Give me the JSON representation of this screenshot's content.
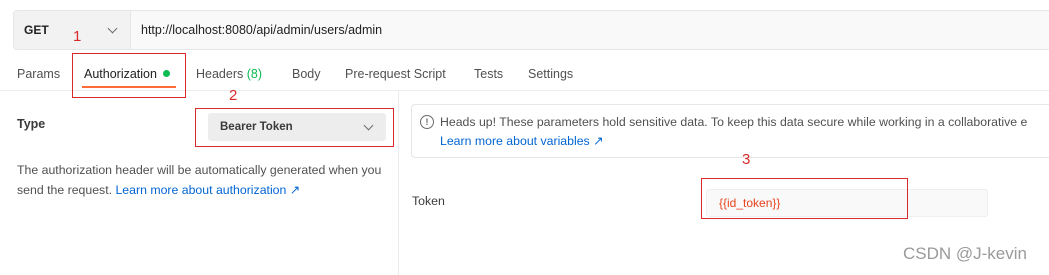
{
  "request": {
    "method": "GET",
    "url": "http://localhost:8080/api/admin/users/admin"
  },
  "tabs": {
    "params": "Params",
    "authorization": "Authorization",
    "headers": "Headers",
    "headers_count": "(8)",
    "body": "Body",
    "pre_request_script": "Pre-request Script",
    "tests": "Tests",
    "settings": "Settings"
  },
  "auth": {
    "type_label": "Type",
    "type_value": "Bearer Token",
    "description": "The authorization header will be automatically generated when you send the request.",
    "learn_more": "Learn more about authorization ↗"
  },
  "alert": {
    "message": "Heads up! These parameters hold sensitive data. To keep this data secure while working in a collaborative e",
    "link": "Learn more about variables ↗"
  },
  "token": {
    "label": "Token",
    "value": "{{id_token}}"
  },
  "annotations": {
    "one": "1",
    "two": "2",
    "three": "3"
  },
  "watermark": "CSDN @J-kevin",
  "colors": {
    "accent": "#ff6c37",
    "link": "#0265d2",
    "status_green": "#0cbb52",
    "annotation_red": "#d92a2a"
  }
}
